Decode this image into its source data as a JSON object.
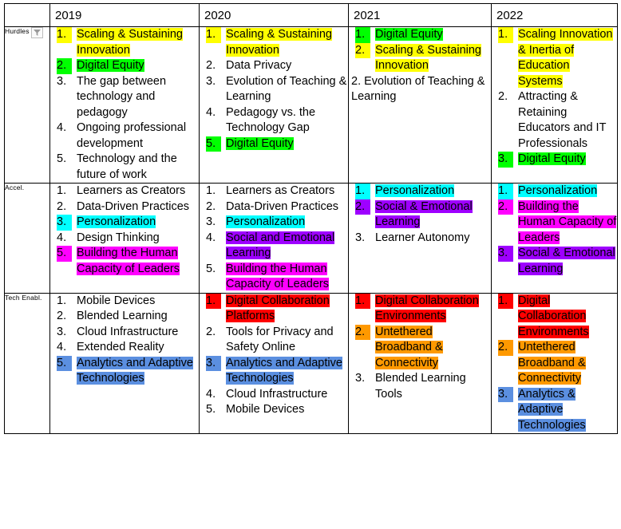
{
  "table": {
    "corner_label": "",
    "columns": [
      {
        "label": "2019"
      },
      {
        "label": "2020"
      },
      {
        "label": "2021"
      },
      {
        "label": "2022"
      }
    ],
    "filter_icon": "filter-dropdown-icon",
    "rows": [
      {
        "header": "Hurdles",
        "has_filter": true,
        "cells": [
          {
            "items": [
              {
                "num": "1.",
                "text": "Scaling & Sustaining Innovation",
                "hl": "yellow",
                "num_hl": "yellow"
              },
              {
                "num": "2.",
                "text": "Digital Equity",
                "hl": "green",
                "num_hl": "green"
              },
              {
                "num": "3.",
                "text": "The gap between technology and pedagogy",
                "hl": "none",
                "num_hl": "none"
              },
              {
                "num": "4.",
                "text": "Ongoing professional development",
                "hl": "none",
                "num_hl": "none"
              },
              {
                "num": "5.",
                "text": "Technology and the future of work",
                "hl": "none",
                "num_hl": "none"
              }
            ],
            "paragraphs": []
          },
          {
            "items": [
              {
                "num": "1.",
                "text": "Scaling & Sustaining Innovation",
                "hl": "yellow",
                "num_hl": "yellow"
              },
              {
                "num": "2.",
                "text": "Data Privacy",
                "hl": "none",
                "num_hl": "none"
              },
              {
                "num": "3.",
                "text": "Evolution of Teaching & Learning",
                "hl": "none",
                "num_hl": "none"
              },
              {
                "num": "4.",
                "text": "Pedagogy vs. the Technology Gap",
                "hl": "none",
                "num_hl": "none"
              },
              {
                "num": "5.",
                "text": "Digital Equity",
                "hl": "green",
                "num_hl": "green"
              }
            ],
            "paragraphs": []
          },
          {
            "items": [
              {
                "num": "1.",
                "text": "Digital Equity",
                "hl": "green",
                "num_hl": "green"
              },
              {
                "num": "2.",
                "text": "Scaling & Sustaining Innovation",
                "hl": "yellow",
                "num_hl": "yellow"
              }
            ],
            "paragraphs": [
              {
                "text": "2. Evolution of Teaching & Learning",
                "hl": "none"
              }
            ]
          },
          {
            "items": [
              {
                "num": "1.",
                "text": "Scaling Innovation & Inertia of Education Systems",
                "hl": "yellow",
                "num_hl": "yellow"
              },
              {
                "num": "2.",
                "text": "Attracting & Retaining Educators and IT Professionals",
                "hl": "none",
                "num_hl": "none"
              },
              {
                "num": "3.",
                "text": "Digital Equity",
                "hl": "green",
                "num_hl": "green"
              }
            ],
            "paragraphs": []
          }
        ]
      },
      {
        "header": "Accel.",
        "has_filter": false,
        "cells": [
          {
            "items": [
              {
                "num": "1.",
                "text": "Learners as Creators",
                "hl": "none",
                "num_hl": "none"
              },
              {
                "num": "2.",
                "text": "Data-Driven Practices",
                "hl": "none",
                "num_hl": "none"
              },
              {
                "num": "3.",
                "text": "Personalization",
                "hl": "cyan",
                "num_hl": "cyan"
              },
              {
                "num": "4.",
                "text": "Design Thinking",
                "hl": "none",
                "num_hl": "none"
              },
              {
                "num": "5.",
                "text": "Building the Human Capacity of Leaders",
                "hl": "magenta",
                "num_hl": "magenta"
              }
            ],
            "paragraphs": []
          },
          {
            "items": [
              {
                "num": "1.",
                "text": "Learners as Creators",
                "hl": "none",
                "num_hl": "none"
              },
              {
                "num": "2.",
                "text": "Data-Driven Practices",
                "hl": "none",
                "num_hl": "none"
              },
              {
                "num": "3.",
                "text": "Personalization",
                "hl": "cyan",
                "num_hl": "none"
              },
              {
                "num": "4.",
                "text": "Social and Emotional Learning",
                "hl": "purple",
                "num_hl": "none"
              },
              {
                "num": "5.",
                "text": "Building the Human Capacity of Leaders",
                "hl": "magenta",
                "num_hl": "none"
              }
            ],
            "paragraphs": []
          },
          {
            "items": [
              {
                "num": "1.",
                "text": "Personalization",
                "hl": "cyan",
                "num_hl": "cyan"
              },
              {
                "num": "2.",
                "text": "Social & Emotional Learning",
                "hl": "purple",
                "num_hl": "purple"
              },
              {
                "num": "3.",
                "text": "Learner Autonomy",
                "hl": "none",
                "num_hl": "none"
              }
            ],
            "paragraphs": []
          },
          {
            "items": [
              {
                "num": "1.",
                "text": "Personalization",
                "hl": "cyan",
                "num_hl": "cyan"
              },
              {
                "num": "2.",
                "text": "Building the Human Capacity of Leaders",
                "hl": "magenta",
                "num_hl": "magenta"
              },
              {
                "num": "3.",
                "text": "Social & Emotional Learning",
                "hl": "purple",
                "num_hl": "purple"
              }
            ],
            "paragraphs": []
          }
        ]
      },
      {
        "header": "Tech Enabl.",
        "has_filter": false,
        "cells": [
          {
            "items": [
              {
                "num": "1.",
                "text": "Mobile Devices",
                "hl": "none",
                "num_hl": "none"
              },
              {
                "num": "2.",
                "text": "Blended Learning",
                "hl": "none",
                "num_hl": "none"
              },
              {
                "num": "3.",
                "text": "Cloud Infrastructure",
                "hl": "none",
                "num_hl": "none"
              },
              {
                "num": "4.",
                "text": "Extended Reality",
                "hl": "none",
                "num_hl": "none"
              },
              {
                "num": "5.",
                "text": "Analytics and Adaptive Technologies",
                "hl": "blue",
                "num_hl": "blue"
              }
            ],
            "paragraphs": []
          },
          {
            "items": [
              {
                "num": "1.",
                "text": "Digital Collaboration Platforms",
                "hl": "red",
                "num_hl": "red"
              },
              {
                "num": "2.",
                "text": "Tools for Privacy and Safety Online",
                "hl": "none",
                "num_hl": "none"
              },
              {
                "num": "3.",
                "text": "Analytics and Adaptive Technologies",
                "hl": "blue",
                "num_hl": "blue"
              },
              {
                "num": "4.",
                "text": "Cloud Infrastructure",
                "hl": "none",
                "num_hl": "none"
              },
              {
                "num": "5.",
                "text": "Mobile Devices",
                "hl": "none",
                "num_hl": "none"
              }
            ],
            "paragraphs": []
          },
          {
            "items": [
              {
                "num": "1.",
                "text": "Digital Collaboration Environments",
                "hl": "red",
                "num_hl": "red"
              },
              {
                "num": "2.",
                "text": "Untethered Broadband & Connectivity",
                "hl": "orange",
                "num_hl": "orange"
              },
              {
                "num": "3.",
                "text": "Blended Learning Tools",
                "hl": "none",
                "num_hl": "none"
              }
            ],
            "paragraphs": []
          },
          {
            "items": [
              {
                "num": "1.",
                "text": "Digital Collaboration Environments",
                "hl": "red",
                "num_hl": "red"
              },
              {
                "num": "2.",
                "text": "Untethered Broadband & Connectivity",
                "hl": "orange",
                "num_hl": "orange"
              },
              {
                "num": "3.",
                "text": "Analytics & Adaptive Technologies",
                "hl": "blue",
                "num_hl": "blue"
              }
            ],
            "paragraphs": []
          }
        ]
      }
    ],
    "highlight_colors": {
      "yellow": "#FFFF00",
      "green": "#00FF00",
      "cyan": "#00FFFF",
      "magenta": "#FF00FF",
      "purple": "#9E00FF",
      "red": "#FF0000",
      "orange": "#FF9900",
      "blue": "#5B8FE0"
    }
  }
}
